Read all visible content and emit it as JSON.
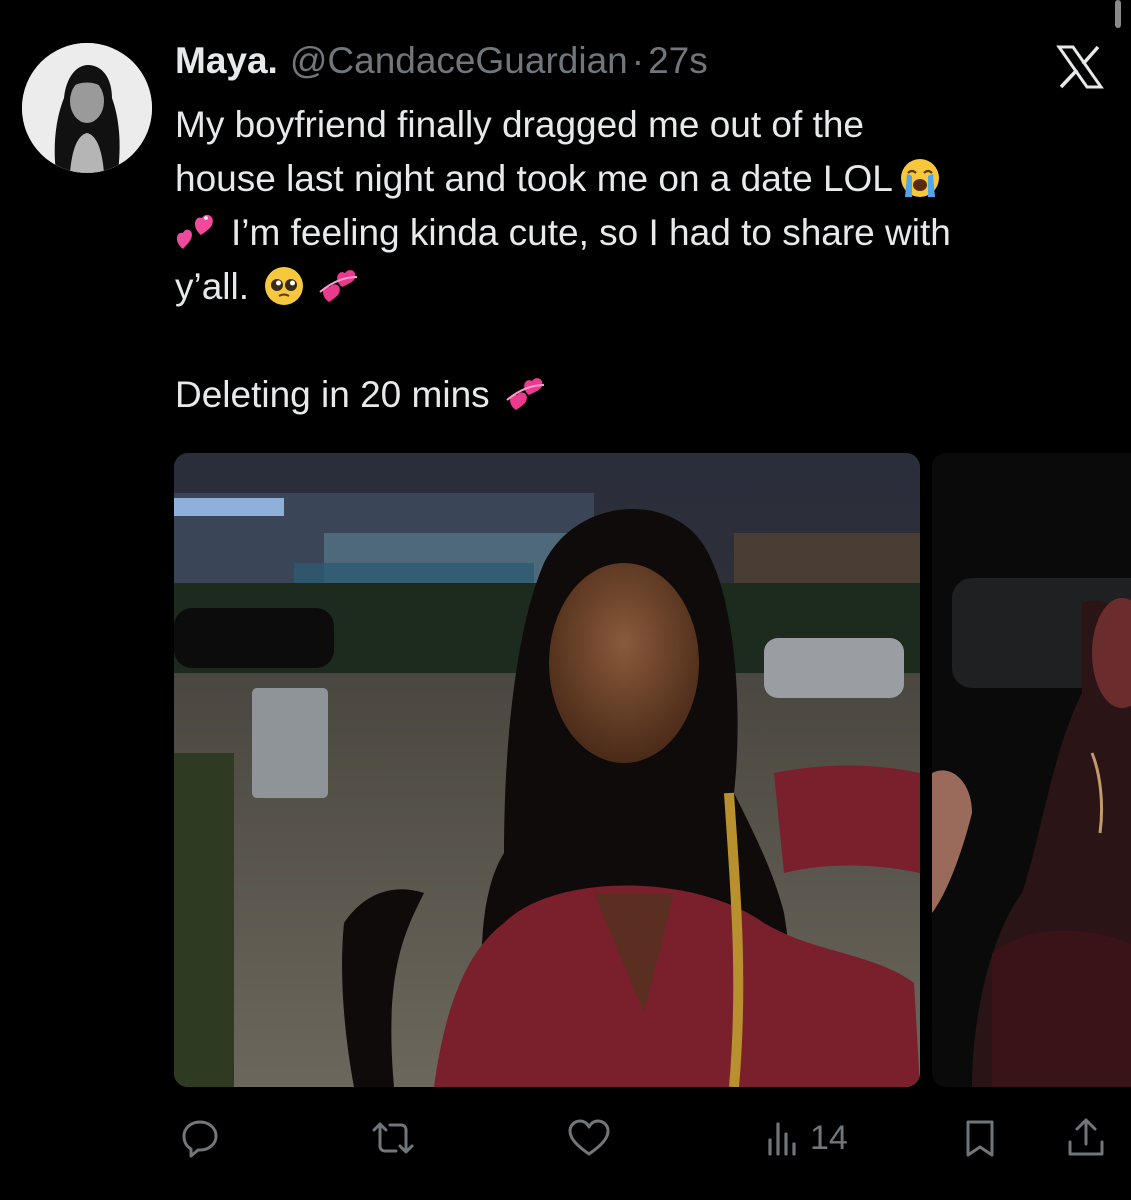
{
  "tweet": {
    "author_name": "Maya.",
    "handle": "@CandaceGuardian",
    "separator": "·",
    "timestamp": "27s",
    "lines": [
      "My boyfriend finally dragged me out of the",
      "house last night and took me on a date LOL",
      "I’m feeling kinda cute, so I had to share with",
      "y’all.",
      "Deleting in 20 mins"
    ]
  },
  "actions": {
    "views_count": "14"
  },
  "colors": {
    "background": "#000000",
    "text_primary": "#e7e9ea",
    "text_secondary": "#71767b"
  },
  "icons": {
    "brand": "x-logo-icon",
    "reply": "reply-icon",
    "retweet": "retweet-icon",
    "like": "like-icon",
    "views": "views-icon",
    "bookmark": "bookmark-icon",
    "share": "share-icon"
  }
}
